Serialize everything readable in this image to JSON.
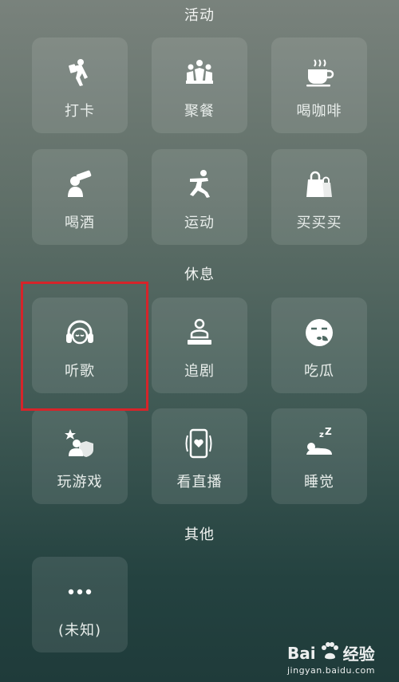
{
  "sections": [
    {
      "title": "活动",
      "items": [
        {
          "label": "打卡",
          "icon": "checkin-icon"
        },
        {
          "label": "聚餐",
          "icon": "dinner-icon"
        },
        {
          "label": "喝咖啡",
          "icon": "coffee-icon"
        },
        {
          "label": "喝酒",
          "icon": "drink-icon"
        },
        {
          "label": "运动",
          "icon": "sport-icon"
        },
        {
          "label": "买买买",
          "icon": "shopping-bag-icon"
        }
      ]
    },
    {
      "title": "休息",
      "items": [
        {
          "label": "听歌",
          "icon": "headphones-icon"
        },
        {
          "label": "追剧",
          "icon": "tv-icon"
        },
        {
          "label": "吃瓜",
          "icon": "eating-melon-icon"
        },
        {
          "label": "玩游戏",
          "icon": "game-icon"
        },
        {
          "label": "看直播",
          "icon": "live-stream-icon"
        },
        {
          "label": "睡觉",
          "icon": "sleep-icon"
        }
      ]
    },
    {
      "title": "其他",
      "items": [
        {
          "label": "(未知)",
          "icon": "more-icon"
        }
      ]
    }
  ],
  "watermark": {
    "brand_left": "Bai",
    "brand_right": "经验",
    "url": "jingyan.baidu.com"
  },
  "colors": {
    "highlight": "#d6242a",
    "tile_bg": "rgba(255,255,255,0.10)"
  }
}
